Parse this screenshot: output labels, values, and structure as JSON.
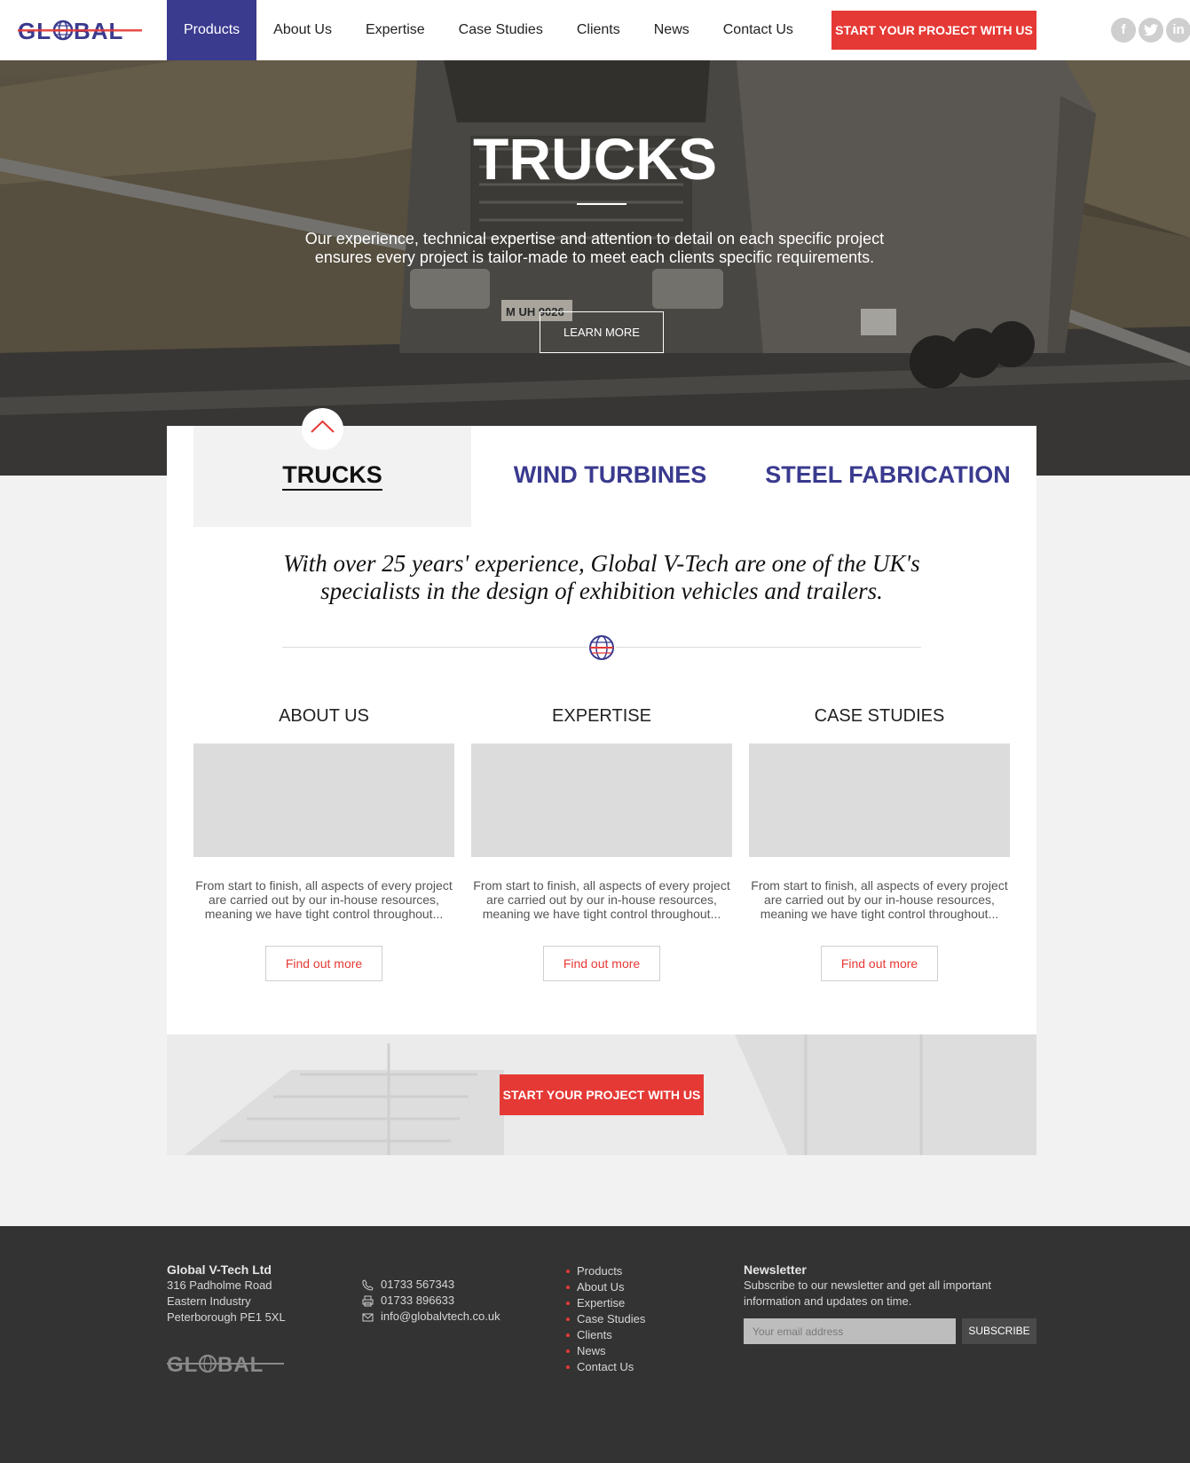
{
  "header": {
    "logo_text": "GLOBAL",
    "nav": [
      "Products",
      "About Us",
      "Expertise",
      "Case Studies",
      "Clients",
      "News",
      "Contact Us"
    ],
    "cta": "START YOUR PROJECT WITH US",
    "social": [
      "facebook-icon",
      "twitter-icon",
      "linkedin-icon"
    ]
  },
  "hero": {
    "title": "TRUCKS",
    "description": "Our experience, technical expertise and attention to detail on each specific project ensures every project is tailor-made to meet each clients specific requirements.",
    "button": "LEARN MORE",
    "plate": "M UH 9026"
  },
  "tabs": [
    "TRUCKS",
    "WIND TURBINES",
    "STEEL FABRICATION"
  ],
  "intro": "With over 25 years' experience, Global V-Tech are one of the UK's specialists in the design of exhibition vehicles and trailers.",
  "columns": [
    {
      "title": "ABOUT US",
      "text": "From start to finish, all aspects of every project are carried out by our in-house resources, meaning we have tight control throughout...",
      "button": "Find out more"
    },
    {
      "title": "EXPERTISE",
      "text": "From start to finish, all aspects of every project are carried out by our in-house resources, meaning we have tight control throughout...",
      "button": "Find out more"
    },
    {
      "title": "CASE STUDIES",
      "text": "From start to finish, all aspects of every project are carried out by our in-house resources, meaning we have tight control throughout...",
      "button": "Find out more"
    }
  ],
  "band": {
    "cta": "START YOUR PROJECT WITH US"
  },
  "footer": {
    "company_name": "Global V-Tech Ltd",
    "address": [
      "316 Padholme Road",
      "Eastern Industry",
      "Peterborough PE1 5XL"
    ],
    "phone": "01733 567343",
    "fax": "01733 896633",
    "email": "info@globalvtech.co.uk",
    "links": [
      "Products",
      "About Us",
      "Expertise",
      "Case Studies",
      "Clients",
      "News",
      "Contact Us"
    ],
    "newsletter_title": "Newsletter",
    "newsletter_text": "Subscribe to our newsletter and get all important information and updates on time.",
    "email_placeholder": "Your email address",
    "subscribe": "SUBSCRIBE",
    "logo_text": "GLOBAL"
  },
  "colors": {
    "brand_blue": "#3a3a8f",
    "brand_red": "#e53935",
    "footer_bg": "#333333"
  }
}
